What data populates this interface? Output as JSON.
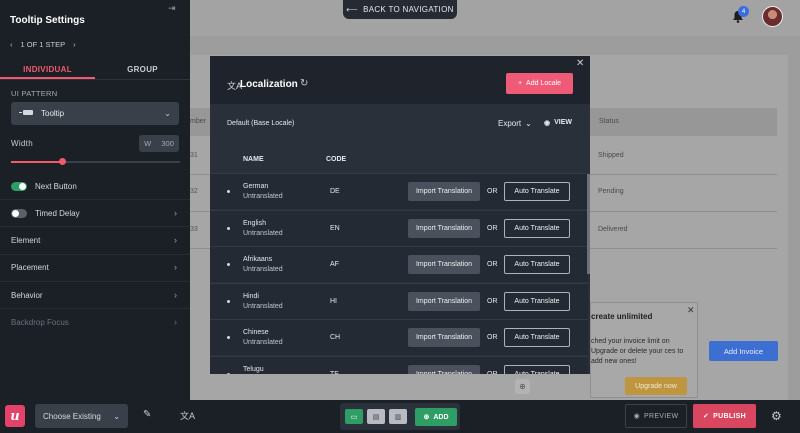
{
  "background": {
    "back_nav_label": "BACK TO NAVIGATION",
    "notification_count": "4",
    "table": {
      "col_number": "mber",
      "col_status": "Status",
      "rows": [
        {
          "num": "31",
          "status": "Shipped"
        },
        {
          "num": "32",
          "status": "Pending"
        },
        {
          "num": "33",
          "status": "Delivered"
        }
      ]
    },
    "add_invoice": "Add Invoice"
  },
  "left_panel": {
    "title": "Tooltip Settings",
    "step": {
      "prev": "‹",
      "label": "1 OF 1 STEP",
      "next": "›"
    },
    "tabs": [
      {
        "label": "INDIVIDUAL",
        "active": true
      },
      {
        "label": "GROUP",
        "active": false
      }
    ],
    "ui_pattern_label": "UI PATTERN",
    "ui_pattern_value": "Tooltip",
    "width_label": "Width",
    "width_prefix": "W",
    "width_value": "300",
    "slider_fraction": 0.3,
    "next_button_label": "Next Button",
    "next_button_on": true,
    "timed_delay_label": "Timed Delay",
    "timed_delay_on": false,
    "sections": [
      "Element",
      "Placement",
      "Behavior",
      "Backdrop Focus"
    ]
  },
  "modal": {
    "title": "Localization",
    "add_locale": "Add Locale",
    "base_locale": "Default (Base Locale)",
    "export": "Export",
    "view": "VIEW",
    "col_name": "NAME",
    "col_code": "CODE",
    "import_label": "Import Translation",
    "or_label": "OR",
    "auto_label": "Auto Translate",
    "locales": [
      {
        "name": "German",
        "status": "Untranslated",
        "code": "DE"
      },
      {
        "name": "English",
        "status": "Untranslated",
        "code": "EN"
      },
      {
        "name": "Afrikaans",
        "status": "Untranslated",
        "code": "AF"
      },
      {
        "name": "Hindi",
        "status": "Untranslated",
        "code": "HI"
      },
      {
        "name": "Chinese",
        "status": "Untranslated",
        "code": "CH"
      },
      {
        "name": "Telugu",
        "status": "Untranslated",
        "code": "TE"
      }
    ]
  },
  "upgrade_popup": {
    "title": "create unlimited",
    "text": "ched your invoice limit on Upgrade or delete your ces to add new ones!",
    "button": "Upgrade now"
  },
  "bottom_bar": {
    "logo": "u",
    "choose_existing": "Choose Existing",
    "add": "ADD",
    "preview": "PREVIEW",
    "publish": "PUBLISH"
  },
  "colors": {
    "accent": "#ef5b76",
    "green": "#2f9e64",
    "panel": "#1b1f26",
    "modal": "#2a303a"
  }
}
